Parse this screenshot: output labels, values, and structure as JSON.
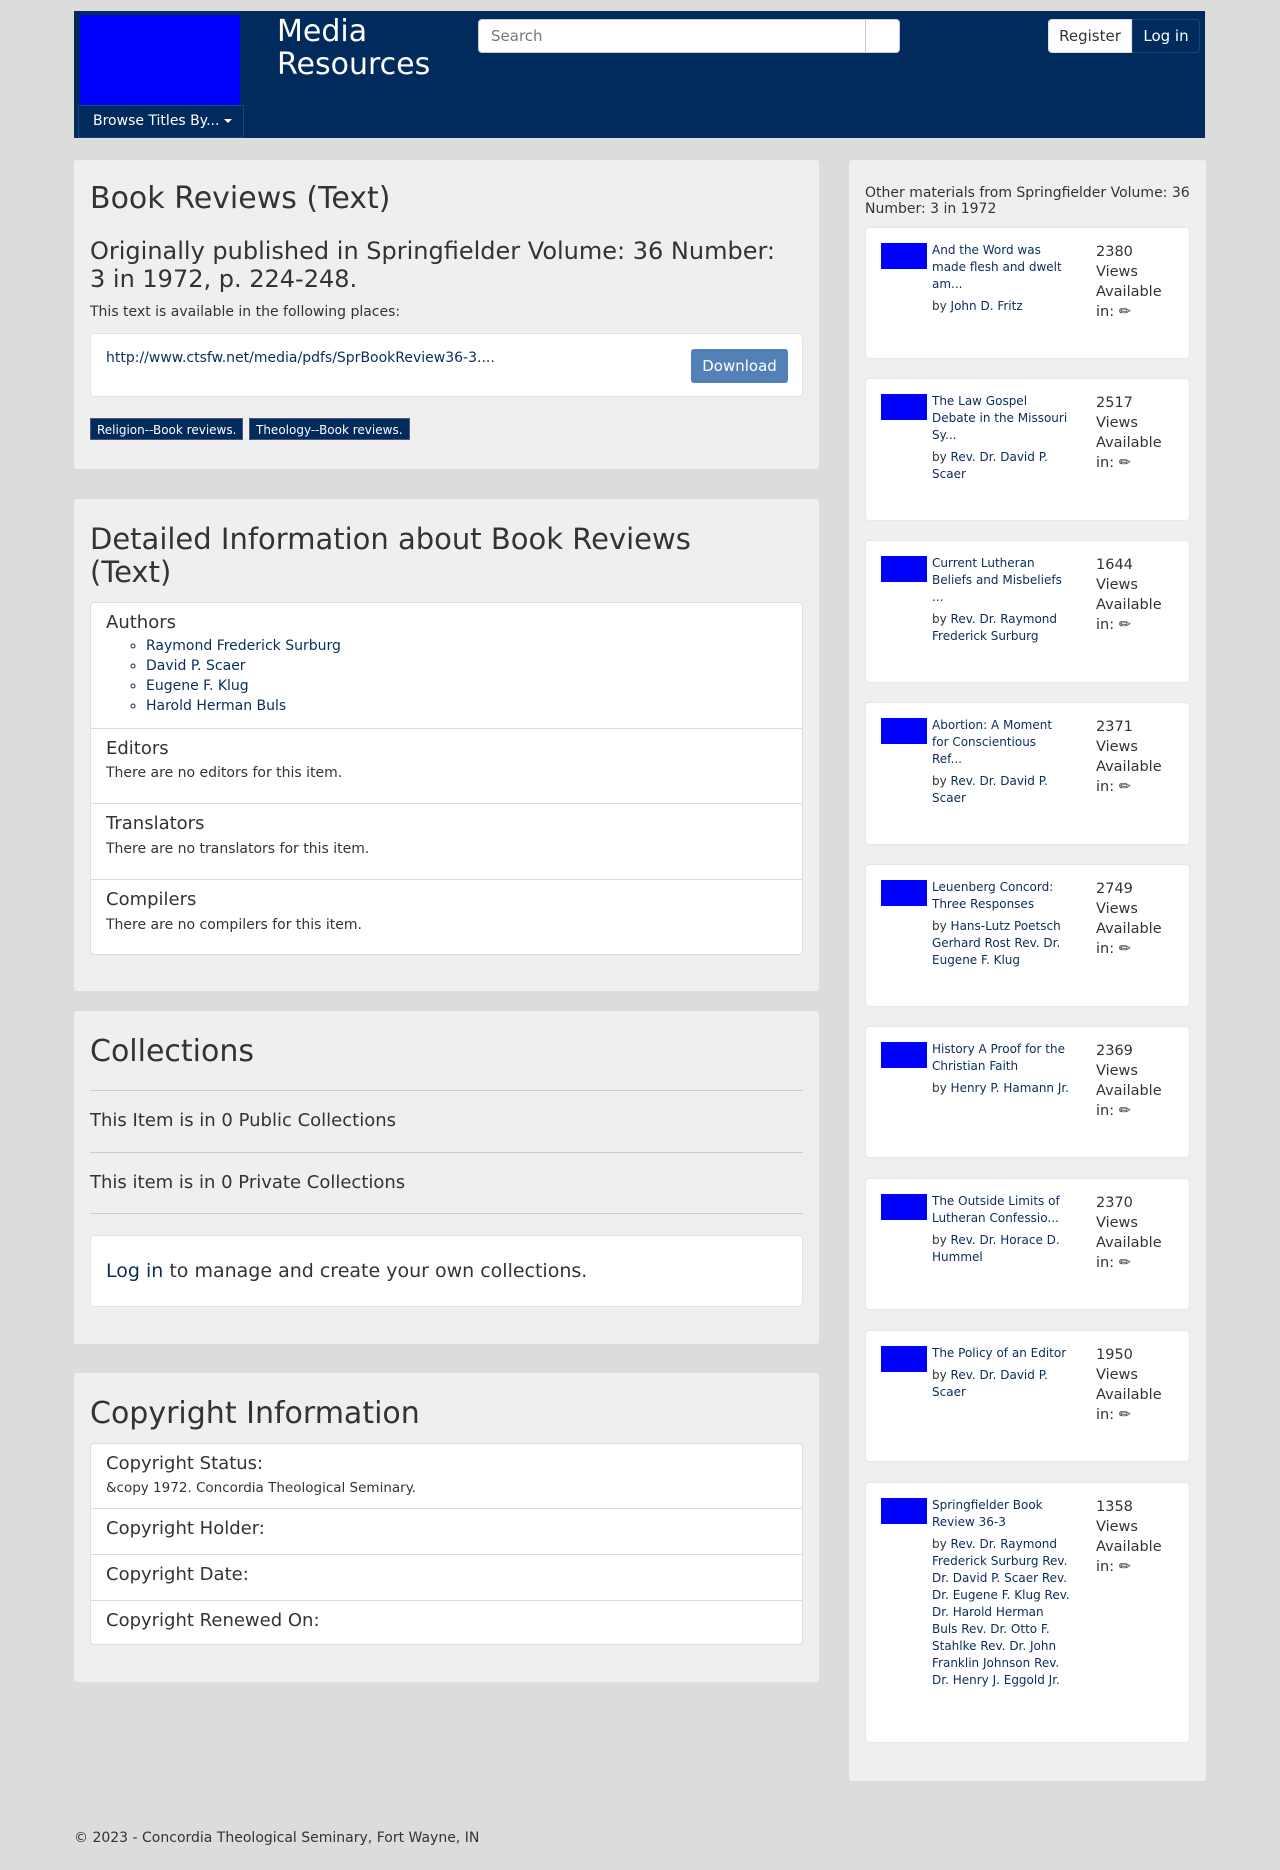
{
  "header": {
    "brand": "Media Resources",
    "search_placeholder": "Search",
    "search_icon": "",
    "register_label": "Register",
    "login_label": "Log in",
    "browse_label": "Browse Titles By..."
  },
  "item": {
    "title": "Book Reviews (Text)",
    "published": "Originally published in Springfielder Volume: 36 Number: 3 in 1972, p. 224-248.",
    "available_text": "This text is available in the following places:",
    "url": "http://www.ctsfw.net/media/pdfs/SprBookReview36-3....",
    "ext_icon": "",
    "download_label": "Download",
    "tags": [
      "Religion--Book reviews.",
      "Theology--Book reviews."
    ]
  },
  "details": {
    "heading": "Detailed Information about Book Reviews (Text)",
    "authors_title": "Authors",
    "authors": [
      "Raymond Frederick Surburg",
      "David P. Scaer",
      "Eugene F. Klug",
      "Harold Herman Buls"
    ],
    "editors_title": "Editors",
    "editors_text": "There are no editors for this item.",
    "translators_title": "Translators",
    "translators_text": "There are no translators for this item.",
    "compilers_title": "Compilers",
    "compilers_text": "There are no compilers for this item."
  },
  "collections": {
    "heading": "Collections",
    "public_text": "This Item is in 0 Public Collections",
    "private_text": "This item is in 0 Private Collections",
    "login_link": "Log in",
    "manage_text": " to manage and create your own collections."
  },
  "copyright": {
    "heading": "Copyright Information",
    "status_label": "Copyright Status:",
    "status_value": "&copy 1972. Concordia Theological Seminary.",
    "holder_label": "Copyright Holder:",
    "date_label": "Copyright Date:",
    "renewed_label": "Copyright Renewed On:"
  },
  "sidebar": {
    "title": "Other materials from Springfielder Volume: 36 Number: 3 in 1972",
    "by_prefix": "by",
    "views_label": "Views",
    "available_label": "Available in:",
    "available_icon": "✏",
    "items": [
      {
        "title": "And the Word was made flesh and dwelt am...",
        "author": "John D. Fritz",
        "views": "2380"
      },
      {
        "title": "The Law Gospel Debate in the Missouri Sy...",
        "author": "Rev. Dr. David P. Scaer",
        "views": "2517"
      },
      {
        "title": "Current Lutheran Beliefs and Misbeliefs ...",
        "author": "Rev. Dr. Raymond Frederick Surburg",
        "views": "1644"
      },
      {
        "title": "Abortion: A Moment for Conscientious Ref...",
        "author": "Rev. Dr. David P. Scaer",
        "views": "2371"
      },
      {
        "title": "Leuenberg Concord: Three Responses",
        "author": "Hans-Lutz Poetsch Gerhard Rost Rev. Dr. Eugene F. Klug",
        "views": "2749"
      },
      {
        "title": "History A Proof for the Christian Faith",
        "author": "Henry P. Hamann Jr.",
        "views": "2369"
      },
      {
        "title": "The Outside Limits of Lutheran Confessio...",
        "author": "Rev. Dr. Horace D. Hummel",
        "views": "2370"
      },
      {
        "title": "The Policy of an Editor",
        "author": "Rev. Dr. David P. Scaer",
        "views": "1950"
      },
      {
        "title": "Springfielder Book Review 36-3",
        "author": "Rev. Dr. Raymond Frederick Surburg Rev. Dr. David P. Scaer Rev. Dr. Eugene F. Klug Rev. Dr. Harold Herman Buls Rev. Dr. Otto F. Stahlke Rev. Dr. John Franklin Johnson Rev. Dr. Henry J. Eggold Jr.",
        "views": "1358"
      }
    ]
  },
  "footer": {
    "text": "© 2023 - Concordia Theological Seminary, Fort Wayne, IN"
  }
}
